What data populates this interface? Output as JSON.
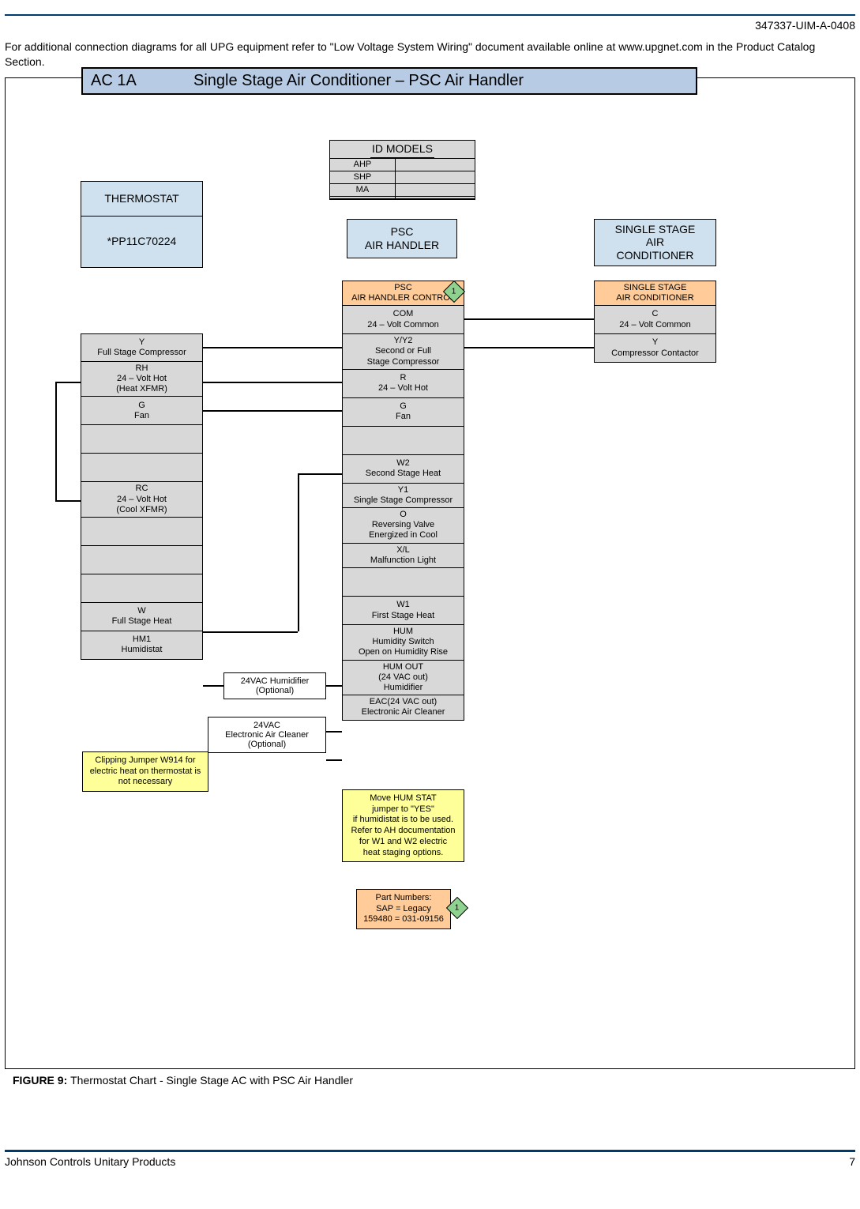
{
  "header": {
    "docnum": "347337-UIM-A-0408",
    "intro": "For additional connection diagrams for all UPG equipment refer to \"Low Voltage System Wiring\" document available online at www.upgnet.com in the Product Catalog Section."
  },
  "diagram": {
    "code": "AC 1A",
    "title": "Single Stage Air Conditioner – PSC Air Handler"
  },
  "idmodels": {
    "header": "ID MODELS",
    "rows": [
      "AHP",
      "SHP",
      "MA"
    ]
  },
  "thermostat": {
    "header": "THERMOSTAT",
    "model": "*PP11C70224",
    "terms": [
      {
        "l1": "Y",
        "l2": "Full Stage Compressor"
      },
      {
        "l1": "RH",
        "l2": "24 – Volt Hot",
        "l3": "(Heat XFMR)"
      },
      {
        "l1": "G",
        "l2": "Fan"
      },
      {
        "l1": "RC",
        "l2": "24 – Volt Hot",
        "l3": "(Cool XFMR)"
      },
      {
        "l1": "W",
        "l2": "Full Stage Heat"
      },
      {
        "l1": "HM1",
        "l2": "Humidistat"
      }
    ]
  },
  "psc": {
    "header": [
      "PSC",
      "AIR HANDLER"
    ],
    "control": [
      "PSC",
      "AIR HANDLER CONTROL"
    ],
    "terms": [
      {
        "l1": "COM",
        "l2": "24 – Volt Common"
      },
      {
        "l1": "Y/Y2",
        "l2": "Second or Full",
        "l3": "Stage Compressor"
      },
      {
        "l1": "R",
        "l2": "24 – Volt Hot"
      },
      {
        "l1": "G",
        "l2": "Fan"
      },
      {
        "l1": "W2",
        "l2": "Second Stage Heat"
      },
      {
        "l1": "Y1",
        "l2": "Single Stage Compressor"
      },
      {
        "l1": "O",
        "l2": "Reversing Valve",
        "l3": "Energized in Cool"
      },
      {
        "l1": "X/L",
        "l2": "Malfunction Light"
      },
      {
        "l1": "W1",
        "l2": "First Stage Heat"
      },
      {
        "l1": "HUM",
        "l2": "Humidity Switch",
        "l3": "Open on Humidity Rise"
      },
      {
        "l1": "HUM OUT",
        "l2": "(24 VAC out)",
        "l3": "Humidifier"
      },
      {
        "l1": "EAC(24 VAC out)",
        "l2": "Electronic Air Cleaner"
      }
    ]
  },
  "ac": {
    "header": [
      "SINGLE STAGE",
      "AIR",
      "CONDITIONER"
    ],
    "control": [
      "SINGLE STAGE",
      "AIR CONDITIONER"
    ],
    "terms": [
      {
        "l1": "C",
        "l2": "24 – Volt Common"
      },
      {
        "l1": "Y",
        "l2": "Compressor Contactor"
      }
    ]
  },
  "optional": {
    "humidifier": [
      "24VAC Humidifier",
      "(Optional)"
    ],
    "eac": [
      "24VAC",
      "Electronic Air Cleaner",
      "(Optional)"
    ]
  },
  "notes": {
    "clipping": "Clipping Jumper W914 for electric heat on thermostat is not necessary",
    "humstat": [
      "Move HUM STAT",
      "jumper to \"YES\"",
      "if humidistat is to be used.",
      "Refer to AH documentation",
      "for W1 and W2 electric",
      "heat staging options."
    ],
    "parts": [
      "Part Numbers:",
      "SAP   =   Legacy",
      "159480  =  031-09156"
    ]
  },
  "markers": {
    "d1": "1",
    "d2": "1"
  },
  "caption": {
    "label": "FIGURE 9: ",
    "text": "Thermostat Chart - Single Stage AC with PSC Air Handler"
  },
  "footer": {
    "brand": "Johnson Controls Unitary Products",
    "page": "7"
  }
}
